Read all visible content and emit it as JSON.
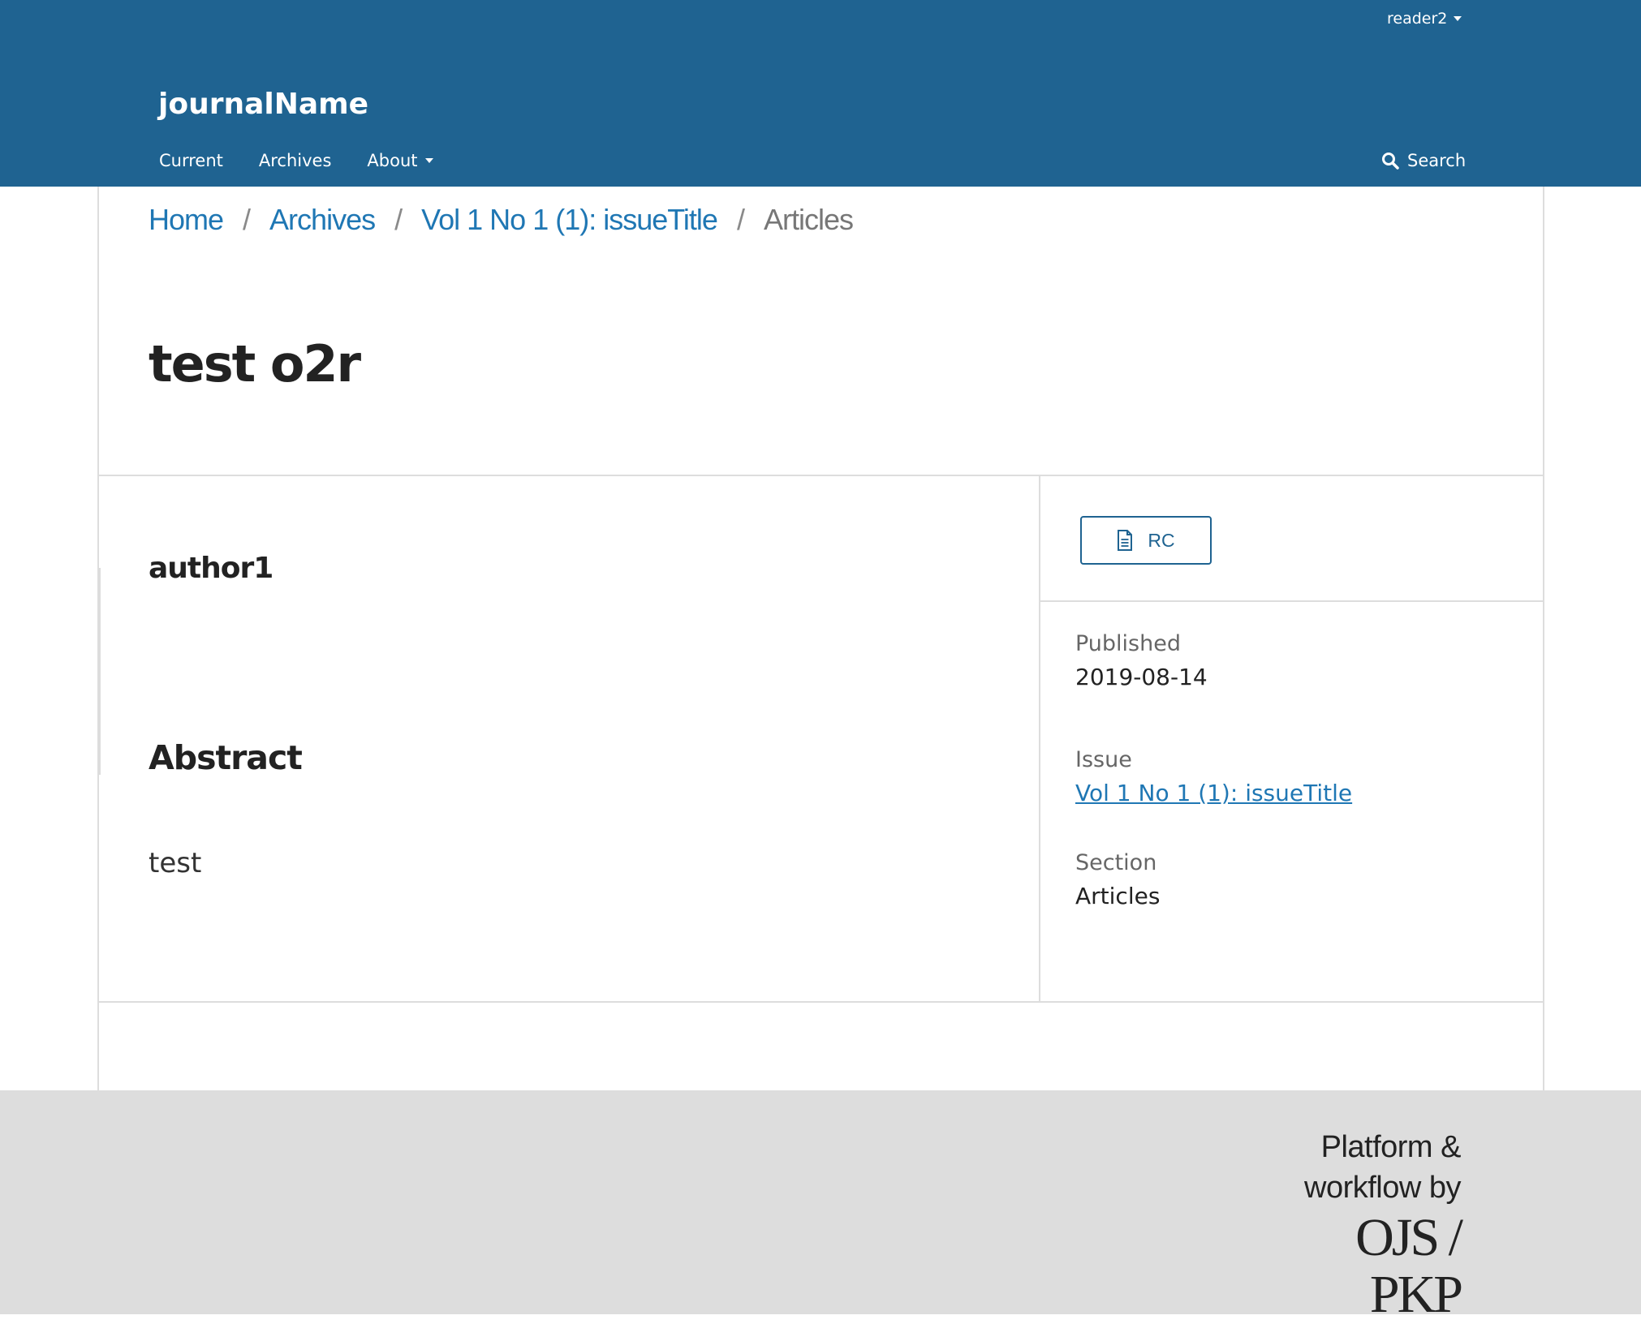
{
  "header": {
    "user": "reader2",
    "site_name": "journalName",
    "nav": [
      {
        "label": "Current"
      },
      {
        "label": "Archives"
      },
      {
        "label": "About"
      }
    ],
    "search_label": "Search"
  },
  "breadcrumb": {
    "home": "Home",
    "archives": "Archives",
    "issue": "Vol 1 No 1 (1): issueTitle",
    "current": "Articles",
    "separator": "/"
  },
  "article": {
    "title": "test o2r",
    "author": "author1",
    "abstract_heading": "Abstract",
    "abstract_body": "test"
  },
  "sidebar": {
    "galley_label": "RC",
    "published_label": "Published",
    "published_value": "2019-08-14",
    "issue_label": "Issue",
    "issue_value": "Vol 1 No 1 (1): issueTitle",
    "section_label": "Section",
    "section_value": "Articles"
  },
  "footer": {
    "line1": "Platform &",
    "line2": "workflow by",
    "logo_text": "OJS / PKP"
  },
  "colors": {
    "header_bg": "#1f6391",
    "link": "#1f77b4",
    "footer_bg": "#dddddd"
  }
}
